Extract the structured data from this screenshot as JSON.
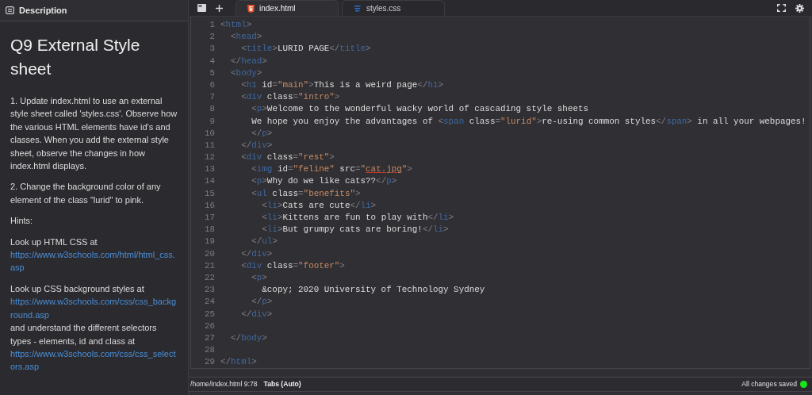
{
  "sidebar": {
    "header": "Description",
    "title": "Q9 External Style sheet",
    "paragraphs": [
      [
        {
          "kind": "text",
          "text": "1. Update index.html to use an external style sheet called 'styles.css'. Observe how the various HTML elements have id's and classes. When you add the external style sheet, observe the changes in how index.html displays."
        }
      ],
      [
        {
          "kind": "text",
          "text": "2. Change the background color of any element of the class \"lurid\" to pink."
        }
      ],
      [
        {
          "kind": "text",
          "text": "Hints:"
        }
      ],
      [
        {
          "kind": "text",
          "text": "Look up HTML CSS at"
        },
        {
          "kind": "link",
          "text": "https://www.w3schools.com/html/html_css.asp"
        }
      ],
      [
        {
          "kind": "text",
          "text": "Look up CSS background styles at"
        },
        {
          "kind": "link",
          "text": "https://www.w3schools.com/css/css_background.asp"
        },
        {
          "kind": "text",
          "text": "and understand the different selectors types - elements, id and class at"
        },
        {
          "kind": "link",
          "text": "https://www.w3schools.com/css/css_selectors.asp"
        }
      ]
    ]
  },
  "tabs": [
    {
      "label": "index.html",
      "kind": "html",
      "selected": true
    },
    {
      "label": "styles.css",
      "kind": "css",
      "selected": false
    }
  ],
  "code": [
    {
      "number": "1",
      "tokens": [
        {
          "kind": "punct",
          "text": "<"
        },
        {
          "kind": "tag",
          "text": "html"
        },
        {
          "kind": "punct",
          "text": ">"
        }
      ]
    },
    {
      "number": "2",
      "tokens": [
        {
          "kind": "punct",
          "text": "  <"
        },
        {
          "kind": "tag",
          "text": "head"
        },
        {
          "kind": "punct",
          "text": ">"
        }
      ]
    },
    {
      "number": "3",
      "tokens": [
        {
          "kind": "punct",
          "text": "    <"
        },
        {
          "kind": "tag",
          "text": "title"
        },
        {
          "kind": "punct",
          "text": ">"
        },
        {
          "kind": "text",
          "text": "LURID PAGE"
        },
        {
          "kind": "punct",
          "text": "</"
        },
        {
          "kind": "tag",
          "text": "title"
        },
        {
          "kind": "punct",
          "text": ">"
        }
      ]
    },
    {
      "number": "4",
      "tokens": [
        {
          "kind": "punct",
          "text": "  </"
        },
        {
          "kind": "tag",
          "text": "head"
        },
        {
          "kind": "punct",
          "text": ">"
        }
      ]
    },
    {
      "number": "5",
      "tokens": [
        {
          "kind": "punct",
          "text": "  <"
        },
        {
          "kind": "tag",
          "text": "body"
        },
        {
          "kind": "punct",
          "text": ">"
        }
      ]
    },
    {
      "number": "6",
      "tokens": [
        {
          "kind": "punct",
          "text": "    <"
        },
        {
          "kind": "tag",
          "text": "h1"
        },
        {
          "kind": "attr",
          "text": " id"
        },
        {
          "kind": "punct",
          "text": "="
        },
        {
          "kind": "string",
          "text": "\"main\""
        },
        {
          "kind": "punct",
          "text": ">"
        },
        {
          "kind": "text",
          "text": "This is a weird page"
        },
        {
          "kind": "punct",
          "text": "</"
        },
        {
          "kind": "tag",
          "text": "h1"
        },
        {
          "kind": "punct",
          "text": ">"
        }
      ]
    },
    {
      "number": "7",
      "tokens": [
        {
          "kind": "punct",
          "text": "    <"
        },
        {
          "kind": "tag",
          "text": "div"
        },
        {
          "kind": "attr",
          "text": " class"
        },
        {
          "kind": "punct",
          "text": "="
        },
        {
          "kind": "string",
          "text": "\"intro\""
        },
        {
          "kind": "punct",
          "text": ">"
        }
      ]
    },
    {
      "number": "8",
      "tokens": [
        {
          "kind": "punct",
          "text": "      <"
        },
        {
          "kind": "tag",
          "text": "p"
        },
        {
          "kind": "punct",
          "text": ">"
        },
        {
          "kind": "text",
          "text": "Welcome to the wonderful wacky world of cascading style sheets"
        }
      ]
    },
    {
      "number": "9",
      "tokens": [
        {
          "kind": "text",
          "text": "      We hope you enjoy the advantages of "
        },
        {
          "kind": "punct",
          "text": "<"
        },
        {
          "kind": "tag",
          "text": "span"
        },
        {
          "kind": "attr",
          "text": " class"
        },
        {
          "kind": "punct",
          "text": "="
        },
        {
          "kind": "string",
          "text": "\"lurid\""
        },
        {
          "kind": "punct",
          "text": ">"
        },
        {
          "kind": "text",
          "text": "re-using common styles"
        },
        {
          "kind": "punct",
          "text": "</"
        },
        {
          "kind": "tag",
          "text": "span"
        },
        {
          "kind": "punct",
          "text": ">"
        },
        {
          "kind": "text",
          "text": " in all your webpages!"
        }
      ]
    },
    {
      "number": "10",
      "tokens": [
        {
          "kind": "punct",
          "text": "      </"
        },
        {
          "kind": "tag",
          "text": "p"
        },
        {
          "kind": "punct",
          "text": ">"
        }
      ]
    },
    {
      "number": "11",
      "tokens": [
        {
          "kind": "punct",
          "text": "    </"
        },
        {
          "kind": "tag",
          "text": "div"
        },
        {
          "kind": "punct",
          "text": ">"
        }
      ]
    },
    {
      "number": "12",
      "tokens": [
        {
          "kind": "punct",
          "text": "    <"
        },
        {
          "kind": "tag",
          "text": "div"
        },
        {
          "kind": "attr",
          "text": " class"
        },
        {
          "kind": "punct",
          "text": "="
        },
        {
          "kind": "string",
          "text": "\"rest\""
        },
        {
          "kind": "punct",
          "text": ">"
        }
      ]
    },
    {
      "number": "13",
      "tokens": [
        {
          "kind": "punct",
          "text": "      <"
        },
        {
          "kind": "tag",
          "text": "img"
        },
        {
          "kind": "attr",
          "text": " id"
        },
        {
          "kind": "punct",
          "text": "="
        },
        {
          "kind": "string",
          "text": "\"feline\""
        },
        {
          "kind": "attr",
          "text": " src"
        },
        {
          "kind": "punct",
          "text": "="
        },
        {
          "kind": "string",
          "text": "\""
        },
        {
          "kind": "url",
          "text": "cat.jpg"
        },
        {
          "kind": "string",
          "text": "\""
        },
        {
          "kind": "punct",
          "text": ">"
        }
      ]
    },
    {
      "number": "14",
      "tokens": [
        {
          "kind": "punct",
          "text": "      <"
        },
        {
          "kind": "tag",
          "text": "p"
        },
        {
          "kind": "punct",
          "text": ">"
        },
        {
          "kind": "text",
          "text": "Why do we like cats??"
        },
        {
          "kind": "punct",
          "text": "</"
        },
        {
          "kind": "tag",
          "text": "p"
        },
        {
          "kind": "punct",
          "text": ">"
        }
      ]
    },
    {
      "number": "15",
      "tokens": [
        {
          "kind": "punct",
          "text": "      <"
        },
        {
          "kind": "tag",
          "text": "ul"
        },
        {
          "kind": "attr",
          "text": " class"
        },
        {
          "kind": "punct",
          "text": "="
        },
        {
          "kind": "string",
          "text": "\"benefits\""
        },
        {
          "kind": "punct",
          "text": ">"
        }
      ]
    },
    {
      "number": "16",
      "tokens": [
        {
          "kind": "punct",
          "text": "        <"
        },
        {
          "kind": "tag",
          "text": "li"
        },
        {
          "kind": "punct",
          "text": ">"
        },
        {
          "kind": "text",
          "text": "Cats are cute"
        },
        {
          "kind": "punct",
          "text": "</"
        },
        {
          "kind": "tag",
          "text": "li"
        },
        {
          "kind": "punct",
          "text": ">"
        }
      ]
    },
    {
      "number": "17",
      "tokens": [
        {
          "kind": "punct",
          "text": "        <"
        },
        {
          "kind": "tag",
          "text": "li"
        },
        {
          "kind": "punct",
          "text": ">"
        },
        {
          "kind": "text",
          "text": "Kittens are fun to play with"
        },
        {
          "kind": "punct",
          "text": "</"
        },
        {
          "kind": "tag",
          "text": "li"
        },
        {
          "kind": "punct",
          "text": ">"
        }
      ]
    },
    {
      "number": "18",
      "tokens": [
        {
          "kind": "punct",
          "text": "        <"
        },
        {
          "kind": "tag",
          "text": "li"
        },
        {
          "kind": "punct",
          "text": ">"
        },
        {
          "kind": "text",
          "text": "But grumpy cats are boring!"
        },
        {
          "kind": "punct",
          "text": "</"
        },
        {
          "kind": "tag",
          "text": "li"
        },
        {
          "kind": "punct",
          "text": ">"
        }
      ]
    },
    {
      "number": "19",
      "tokens": [
        {
          "kind": "punct",
          "text": "      </"
        },
        {
          "kind": "tag",
          "text": "ul"
        },
        {
          "kind": "punct",
          "text": ">"
        }
      ]
    },
    {
      "number": "20",
      "tokens": [
        {
          "kind": "punct",
          "text": "    </"
        },
        {
          "kind": "tag",
          "text": "div"
        },
        {
          "kind": "punct",
          "text": ">"
        }
      ]
    },
    {
      "number": "21",
      "tokens": [
        {
          "kind": "punct",
          "text": "    <"
        },
        {
          "kind": "tag",
          "text": "div"
        },
        {
          "kind": "attr",
          "text": " class"
        },
        {
          "kind": "punct",
          "text": "="
        },
        {
          "kind": "string",
          "text": "\"footer\""
        },
        {
          "kind": "punct",
          "text": ">"
        }
      ]
    },
    {
      "number": "22",
      "tokens": [
        {
          "kind": "punct",
          "text": "      <"
        },
        {
          "kind": "tag",
          "text": "p"
        },
        {
          "kind": "punct",
          "text": ">"
        }
      ]
    },
    {
      "number": "23",
      "tokens": [
        {
          "kind": "text",
          "text": "        &copy; 2020 University of Technology Sydney"
        }
      ]
    },
    {
      "number": "24",
      "tokens": [
        {
          "kind": "punct",
          "text": "      </"
        },
        {
          "kind": "tag",
          "text": "p"
        },
        {
          "kind": "punct",
          "text": ">"
        }
      ]
    },
    {
      "number": "25",
      "tokens": [
        {
          "kind": "punct",
          "text": "    </"
        },
        {
          "kind": "tag",
          "text": "div"
        },
        {
          "kind": "punct",
          "text": ">"
        }
      ]
    },
    {
      "number": "26"
    },
    {
      "number": "27",
      "tokens": [
        {
          "kind": "punct",
          "text": "  </"
        },
        {
          "kind": "tag",
          "text": "body"
        },
        {
          "kind": "punct",
          "text": ">"
        }
      ]
    },
    {
      "number": "28"
    },
    {
      "number": "29",
      "tokens": [
        {
          "kind": "punct",
          "text": "</"
        },
        {
          "kind": "tag",
          "text": "html"
        },
        {
          "kind": "punct",
          "text": ">"
        }
      ]
    }
  ],
  "status_bar": {
    "path": "/home/index.html",
    "position": "9:78",
    "indent": "Tabs (Auto)",
    "save_status": "All changes saved",
    "saved": true
  }
}
